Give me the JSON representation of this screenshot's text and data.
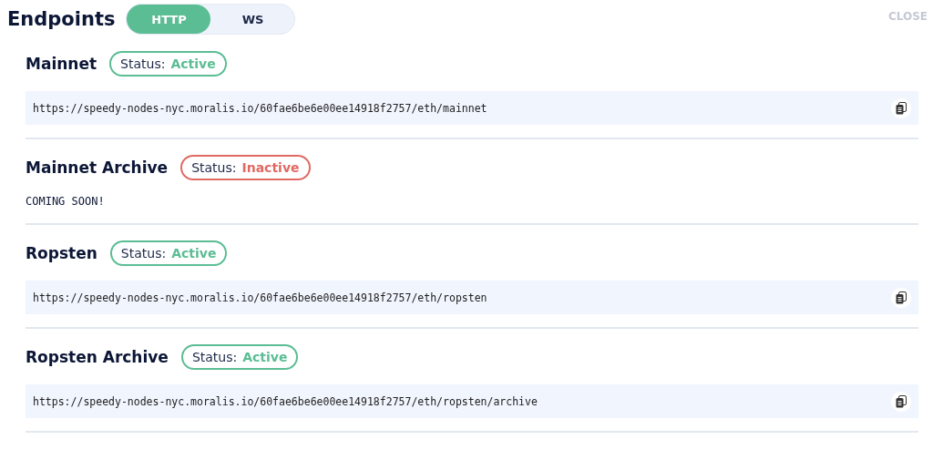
{
  "header": {
    "title": "Endpoints",
    "tabs": [
      {
        "label": "HTTP",
        "selected": true
      },
      {
        "label": "WS",
        "selected": false
      }
    ],
    "close": "CLOSE"
  },
  "endpoints": [
    {
      "name": "Mainnet",
      "status_label": "Status:",
      "status": "Active",
      "active": true,
      "kind": "url",
      "text": "https://speedy-nodes-nyc.moralis.io/60fae6be6e00ee14918f2757/eth/mainnet"
    },
    {
      "name": "Mainnet Archive",
      "status_label": "Status:",
      "status": "Inactive",
      "active": false,
      "kind": "message",
      "text": "COMING SOON!"
    },
    {
      "name": "Ropsten",
      "status_label": "Status:",
      "status": "Active",
      "active": true,
      "kind": "url",
      "text": "https://speedy-nodes-nyc.moralis.io/60fae6be6e00ee14918f2757/eth/ropsten"
    },
    {
      "name": "Ropsten Archive",
      "status_label": "Status:",
      "status": "Active",
      "active": true,
      "kind": "url",
      "text": "https://speedy-nodes-nyc.moralis.io/60fae6be6e00ee14918f2757/eth/ropsten/archive"
    }
  ]
}
